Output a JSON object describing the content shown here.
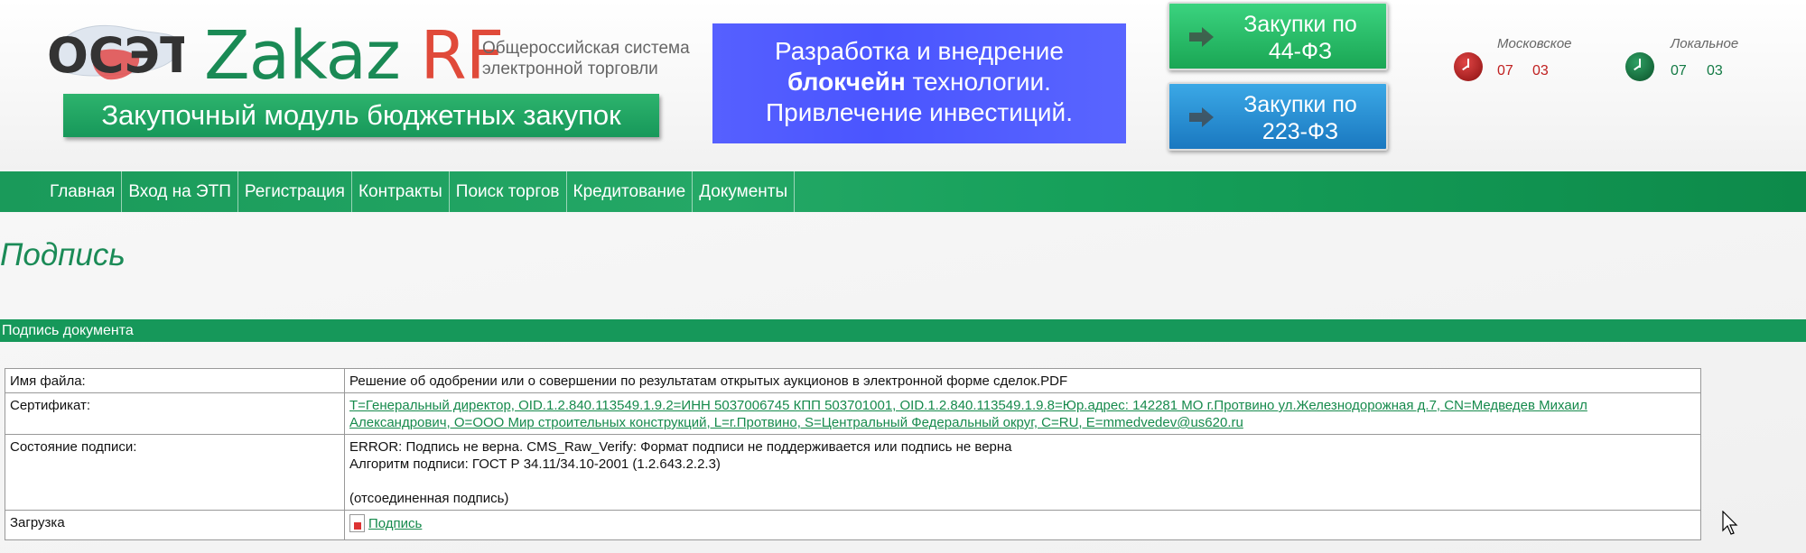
{
  "header": {
    "logo_oset": "ОСЭТ",
    "logo_zakaz": "Zakaz",
    "logo_rf": "RF",
    "logo_subtitle_line1": "Общероссийская система",
    "logo_subtitle_line2": "электронной торговли",
    "slogan": "Закупочный модуль бюджетных закупок",
    "banner_line1": "Разработка и внедрение",
    "banner_line2_bold": "блокчейн",
    "banner_line2_rest": " технологии.",
    "banner_line3": "Привлечение инвестиций.",
    "btn_44_line1": "Закупки по",
    "btn_44_line2": "44-ФЗ",
    "btn_223_line1": "Закупки по",
    "btn_223_line2": "223-ФЗ",
    "clock_moscow_label": "Московское",
    "clock_moscow_hours": "07",
    "clock_moscow_minutes": "03",
    "clock_local_label": "Локальное",
    "clock_local_hours": "07",
    "clock_local_minutes": "03"
  },
  "nav": {
    "items": [
      "Главная",
      "Вход на ЭТП",
      "Регистрация",
      "Контракты",
      "Поиск торгов",
      "Кредитование",
      "Документы"
    ]
  },
  "page": {
    "title": "Подпись",
    "section_title": "Подпись документа"
  },
  "table": {
    "file_label": "Имя файла:",
    "file_value": "Решение об одобрении или о совершении по результатам открытых аукционов в электронной форме сделок.PDF",
    "cert_label": "Сертификат:",
    "cert_line1": "T=Генеральный директор, OID.1.2.840.113549.1.9.2=ИНН 5037006745 КПП 503701001, OID.1.2.840.113549.1.9.8=Юр.адрес: 142281 МО г.Протвино ул.Железнодорожная д.7, CN=Медведев Михаил",
    "cert_line2": "Александрович, O=ООО Мир строительных конструкций, L=г.Протвино, S=Центральный Федеральный округ, C=RU, E=mmedvedev@us620.ru",
    "status_label": "Состояние подписи:",
    "status_line1": "ERROR: Подпись не верна. CMS_Raw_Verify: Формат подписи не поддерживается или подпись не верна",
    "status_line2": "Алгоритм подписи: ГОСТ Р 34.11/34.10-2001 (1.2.643.2.2.3)",
    "status_line3": "(отсоединенная подпись)",
    "download_label": "Загрузка",
    "download_link": "Подпись"
  },
  "colors": {
    "brand_green": "#16985a",
    "link_green": "#168a4c",
    "banner_blue": "#4a55ff",
    "btn_44": "#1aa654",
    "btn_223": "#1a78c0"
  }
}
